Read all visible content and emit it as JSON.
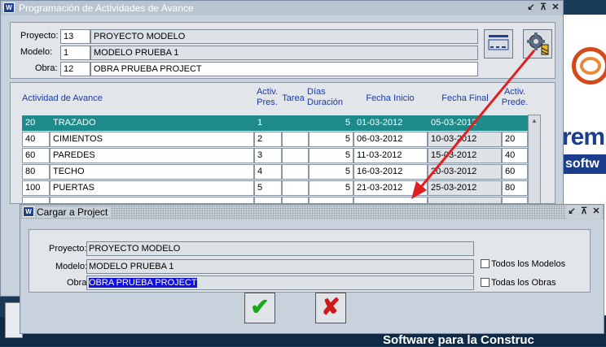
{
  "main_window": {
    "title": "Programación de Actividades de Avance",
    "controls": [
      "↙",
      "⊼",
      "✕"
    ],
    "header": {
      "proyecto_label": "Proyecto:",
      "proyecto_code": "13",
      "proyecto_name": "PROYECTO MODELO",
      "modelo_label": "Modelo:",
      "modelo_code": "1",
      "modelo_name": "MODELO PRUEBA 1",
      "obra_label": "Obra:",
      "obra_code": "12",
      "obra_name": "OBRA PRUEBA PROJECT"
    },
    "toolbar": {
      "list_icon": "list-view-icon",
      "gear_icon": "export-gear-icon"
    },
    "grid": {
      "columns": [
        "Actividad de Avance",
        "Activ. Pres.",
        "Tarea",
        "Días Duración",
        "Fecha Inicio",
        "Fecha Final",
        "Activ. Prede."
      ],
      "rows": [
        {
          "code": "20",
          "name": "TRAZADO",
          "pres": "1",
          "tarea": "",
          "dur": "5",
          "inicio": "01-03-2012",
          "final": "05-03-2012",
          "prede": ""
        },
        {
          "code": "40",
          "name": "CIMIENTOS",
          "pres": "2",
          "tarea": "",
          "dur": "5",
          "inicio": "06-03-2012",
          "final": "10-03-2012",
          "prede": "20"
        },
        {
          "code": "60",
          "name": "PAREDES",
          "pres": "3",
          "tarea": "",
          "dur": "5",
          "inicio": "11-03-2012",
          "final": "15-03-2012",
          "prede": "40"
        },
        {
          "code": "80",
          "name": "TECHO",
          "pres": "4",
          "tarea": "",
          "dur": "5",
          "inicio": "16-03-2012",
          "final": "20-03-2012",
          "prede": "60"
        },
        {
          "code": "100",
          "name": "PUERTAS",
          "pres": "5",
          "tarea": "",
          "dur": "5",
          "inicio": "21-03-2012",
          "final": "25-03-2012",
          "prede": "80"
        }
      ]
    }
  },
  "dialog": {
    "title": "Cargar a Project",
    "controls": [
      "↙",
      "⊼",
      "✕"
    ],
    "proyecto_label": "Proyecto:",
    "proyecto_value": "PROYECTO MODELO",
    "modelo_label": "Modelo:",
    "modelo_value": "MODELO PRUEBA 1",
    "obra_label": "Obra:",
    "obra_value": "OBRA PRUEBA PROJECT",
    "todos_modelos": "Todos los Modelos",
    "todas_obras": "Todas los Obras",
    "ok_glyph": "✔",
    "cancel_glyph": "✘"
  },
  "background": {
    "brand_partial": "rem",
    "brand_sub_partial": "softw",
    "bottom_text": "Software para la Construc"
  },
  "colors": {
    "selected_row": "#1e8a8a",
    "header_text": "#1a3aa8",
    "arrow": "#e02020",
    "highlight": "#1010e0"
  }
}
